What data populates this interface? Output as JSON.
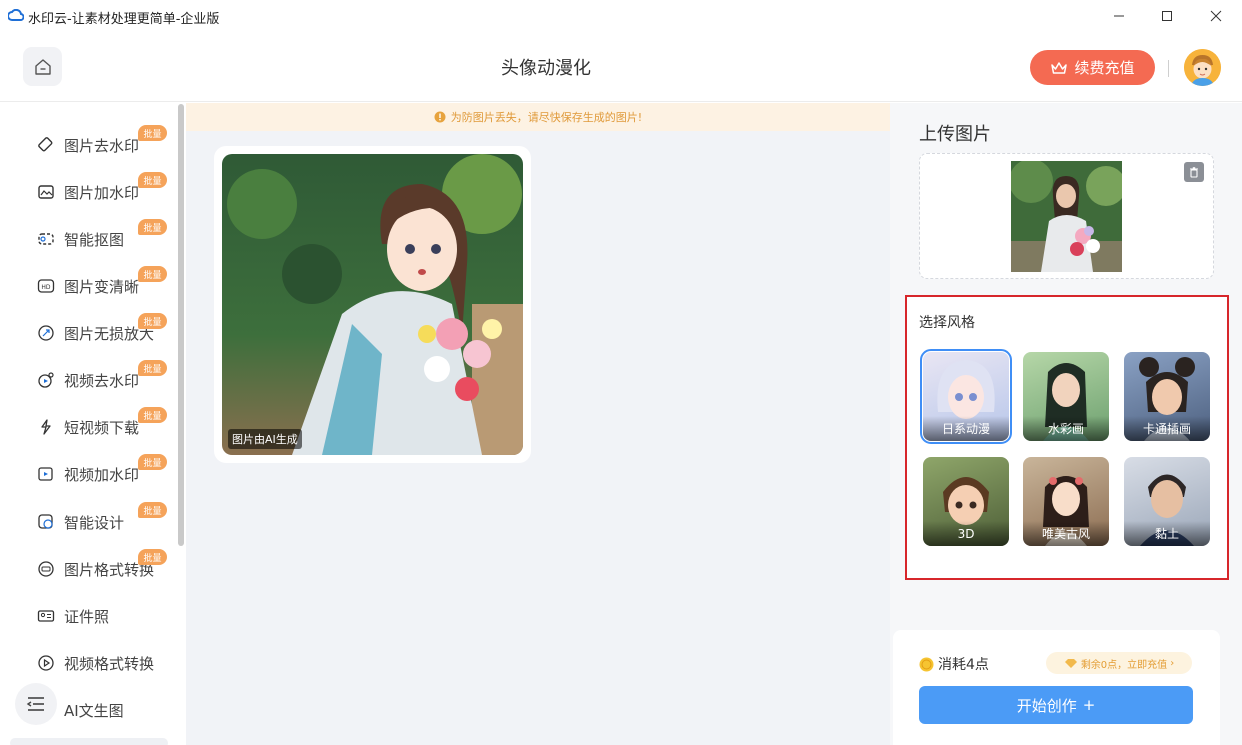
{
  "window": {
    "title": "水印云-让素材处理更简单-企业版",
    "minimize_icon": "minimize-icon",
    "maximize_icon": "maximize-icon",
    "close_icon": "close-icon"
  },
  "header": {
    "page_title": "头像动漫化",
    "recharge_label": "续费充值"
  },
  "sidebar": {
    "items": [
      {
        "label": "图片去水印",
        "badge": "批量",
        "icon": "eraser-icon"
      },
      {
        "label": "图片加水印",
        "badge": "批量",
        "icon": "image-add-icon"
      },
      {
        "label": "智能抠图",
        "badge": "批量",
        "icon": "cutout-icon"
      },
      {
        "label": "图片变清晰",
        "badge": "批量",
        "icon": "hd-icon"
      },
      {
        "label": "图片无损放大",
        "badge": "批量",
        "icon": "zoom-icon"
      },
      {
        "label": "视频去水印",
        "badge": "批量",
        "icon": "video-eraser-icon"
      },
      {
        "label": "短视频下载",
        "badge": "批量",
        "icon": "download-icon"
      },
      {
        "label": "视频加水印",
        "badge": "批量",
        "icon": "video-add-icon"
      },
      {
        "label": "智能设计",
        "badge": "批量",
        "icon": "design-icon"
      },
      {
        "label": "图片格式转换",
        "badge": "批量",
        "icon": "format-icon"
      },
      {
        "label": "证件照",
        "badge": "",
        "icon": "id-photo-icon"
      },
      {
        "label": "视频格式转换",
        "badge": "",
        "icon": "play-icon"
      },
      {
        "label": "AI文生图",
        "badge": "",
        "icon": "ai-image-icon"
      }
    ]
  },
  "main": {
    "notice": "为防图片丢失，请尽快保存生成的图片!",
    "result_tag": "图片由AI生成"
  },
  "right_panel": {
    "upload_title": "上传图片",
    "style_title": "选择风格",
    "styles": [
      {
        "label": "日系动漫",
        "selected": true
      },
      {
        "label": "水彩画",
        "selected": false
      },
      {
        "label": "卡通插画",
        "selected": false
      },
      {
        "label": "3D",
        "selected": false
      },
      {
        "label": "唯美古风",
        "selected": false
      },
      {
        "label": "黏土",
        "selected": false
      }
    ],
    "cost": "消耗4点",
    "balance": "剩余0点，立即充值",
    "start_label": "开始创作"
  },
  "colors": {
    "accent_blue": "#4b9bf6",
    "recharge_orange": "#f46a52",
    "highlight_red": "#d7262b",
    "badge_orange": "#f5a35a"
  }
}
